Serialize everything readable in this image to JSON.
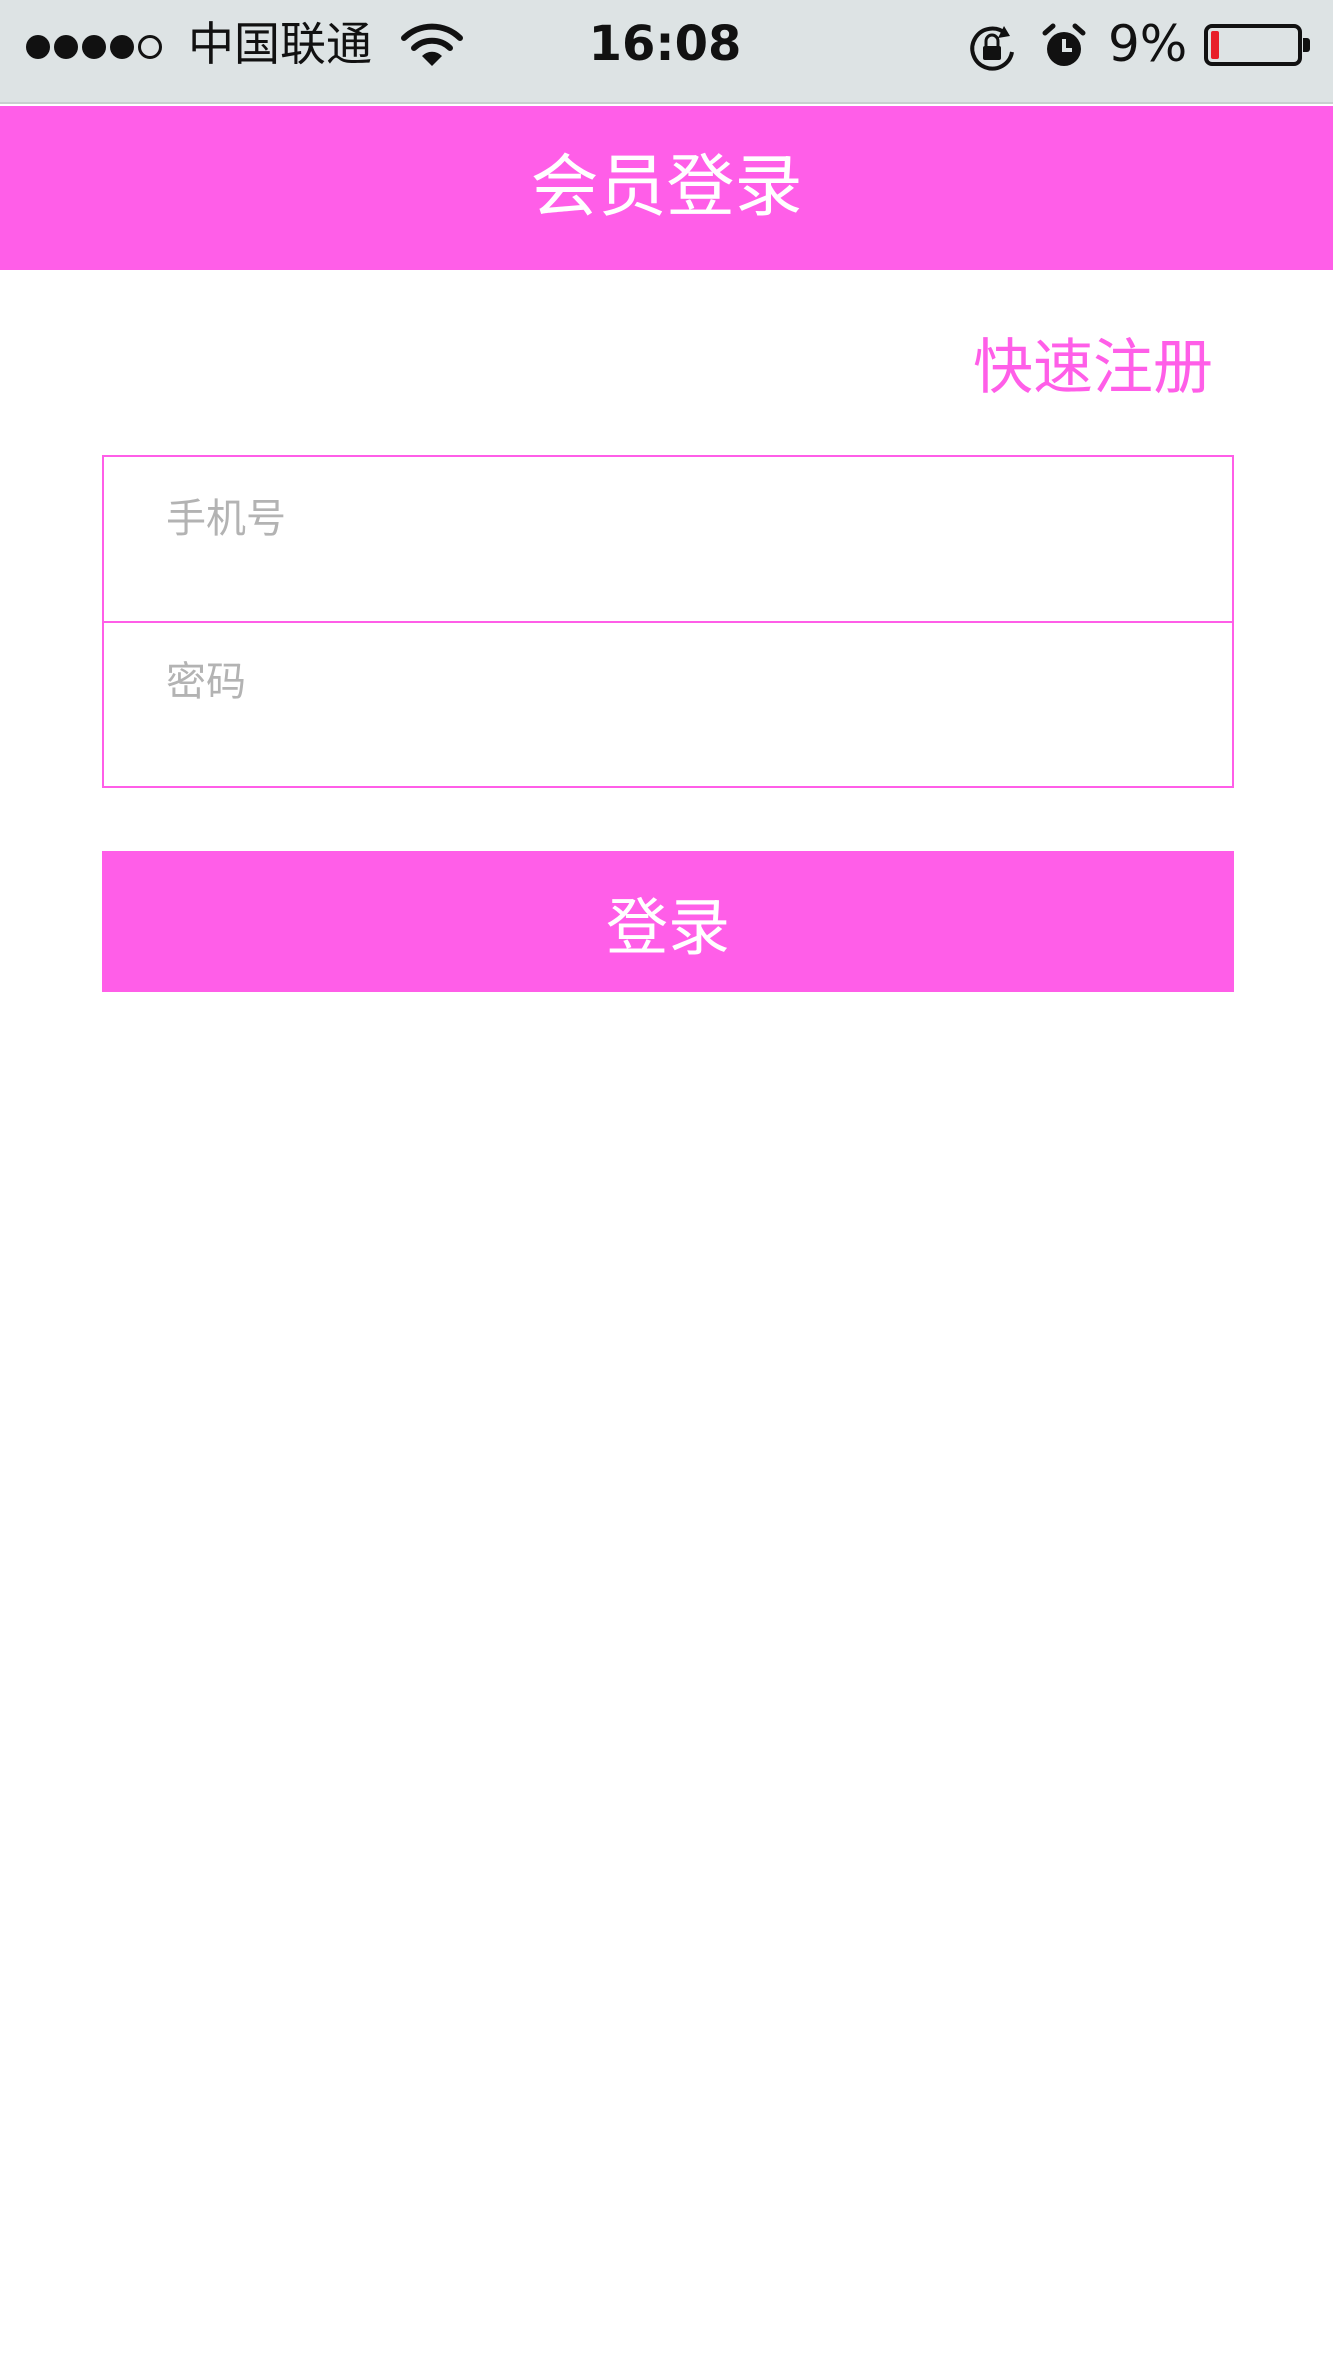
{
  "status_bar": {
    "signal_bars_filled": 4,
    "signal_bars_total": 5,
    "carrier": "中国联通",
    "time": "16:08",
    "battery_percent": "9%",
    "battery_level": 0.09,
    "battery_color": "#e8202a",
    "icons": [
      "wifi-icon",
      "rotation-lock-icon",
      "alarm-icon",
      "battery-icon"
    ]
  },
  "nav": {
    "title": "会员登录",
    "background": "#ff5ee8"
  },
  "register": {
    "label": "快速注册"
  },
  "form": {
    "phone_placeholder": "手机号",
    "phone_value": "",
    "password_placeholder": "密码",
    "password_value": ""
  },
  "login": {
    "label": "登录"
  },
  "colors": {
    "accent": "#ff5ee8",
    "placeholder": "#b3b3b3",
    "status_bar_bg": "#dde3e4"
  }
}
